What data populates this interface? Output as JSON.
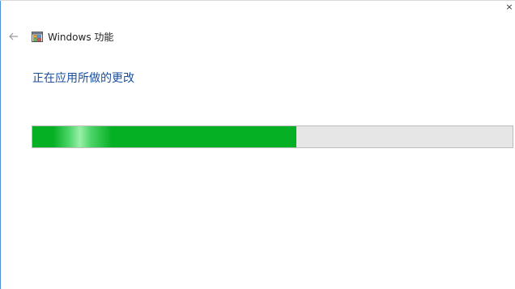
{
  "window": {
    "title": "Windows 功能",
    "close_glyph": "×"
  },
  "status": {
    "heading": "正在应用所做的更改"
  },
  "progress": {
    "value": 0.55,
    "color": "#06b025",
    "track_color": "#e6e6e6"
  },
  "icons": {
    "back": "back-arrow-icon",
    "app": "windows-features-icon",
    "close": "close-icon"
  }
}
